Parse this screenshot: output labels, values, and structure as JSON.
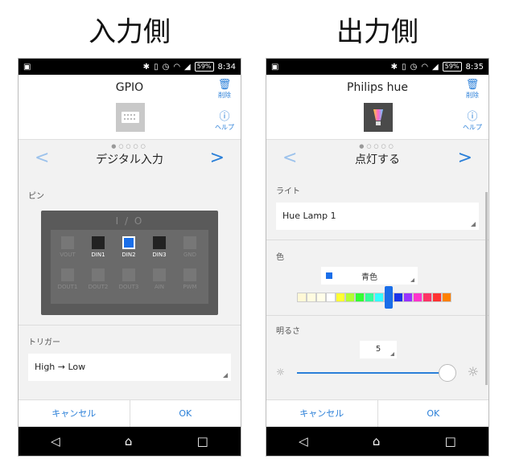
{
  "captions": {
    "left": "入力側",
    "right": "出力側"
  },
  "status_left": {
    "battery": "59%",
    "time": "8:34"
  },
  "status_right": {
    "battery": "59%",
    "time": "8:35"
  },
  "common": {
    "delete_label": "削除",
    "help_label": "ヘルプ",
    "cancel_label": "キャンセル",
    "ok_label": "OK",
    "prev_symbol": "<",
    "next_symbol": ">",
    "page_dots": "●○○○○"
  },
  "left": {
    "title": "GPIO",
    "nav_title": "デジタル入力",
    "pin_section_label": "ピン",
    "io_title": "I / O",
    "pins_top": [
      {
        "label": "VOUT",
        "state": "disabled"
      },
      {
        "label": "DIN1",
        "state": "active"
      },
      {
        "label": "DIN2",
        "state": "selected"
      },
      {
        "label": "DIN3",
        "state": "active"
      },
      {
        "label": "GND",
        "state": "disabled"
      }
    ],
    "pins_bottom": [
      {
        "label": "DOUT1",
        "state": "disabled"
      },
      {
        "label": "DOUT2",
        "state": "disabled"
      },
      {
        "label": "DOUT3",
        "state": "disabled"
      },
      {
        "label": "AIN",
        "state": "disabled"
      },
      {
        "label": "PWM",
        "state": "disabled"
      }
    ],
    "trigger_label": "トリガー",
    "trigger_value": "High → Low"
  },
  "right": {
    "title": "Philips hue",
    "nav_title": "点灯する",
    "light_label": "ライト",
    "light_value": "Hue Lamp 1",
    "color_label": "色",
    "color_value": "青色",
    "palette": [
      "#fff8d6",
      "#fffbe0",
      "#fffde8",
      "#ffffff",
      "#ffff33",
      "#b2ff33",
      "#33ff33",
      "#33ff99",
      "#33ffff",
      "#1a6ee8",
      "#1a33e8",
      "#9933ff",
      "#ff33cc",
      "#ff3366",
      "#ff3333",
      "#ff8000"
    ],
    "palette_selected_index": 9,
    "brightness_label": "明るさ",
    "brightness_value": "5",
    "brightness_level_fraction": 1.0
  }
}
